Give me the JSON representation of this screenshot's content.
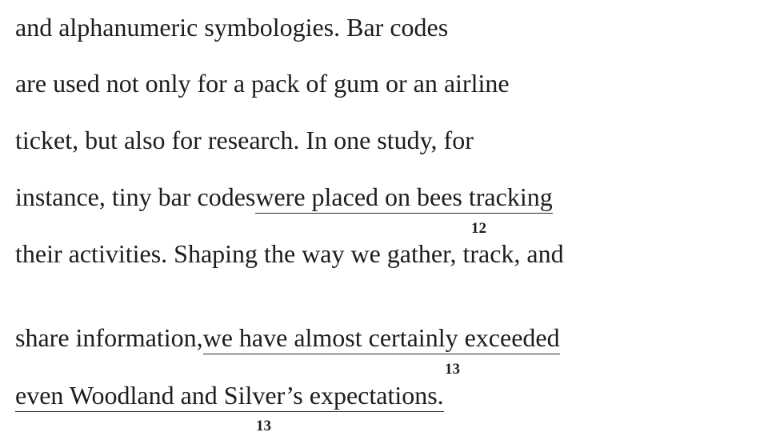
{
  "passage": {
    "line1": "and alphanumeric symbologies. Bar codes",
    "line2": "are used not only for a pack of gum or an airline",
    "line3": "ticket, but also for research. In one study, for",
    "line4_plain": "instance, tiny bar codes ",
    "line4_underlined": "were placed on bees tracking",
    "line5": "their activities. Shaping the way we gather, track, and",
    "line6_plain": "share information, ",
    "line6_underlined": "we have almost certainly exceeded",
    "line7_underlined": "even Woodland and Silver’s expectations."
  },
  "question_markers": {
    "q12": "12",
    "q13a": "13",
    "q13b": "13"
  }
}
